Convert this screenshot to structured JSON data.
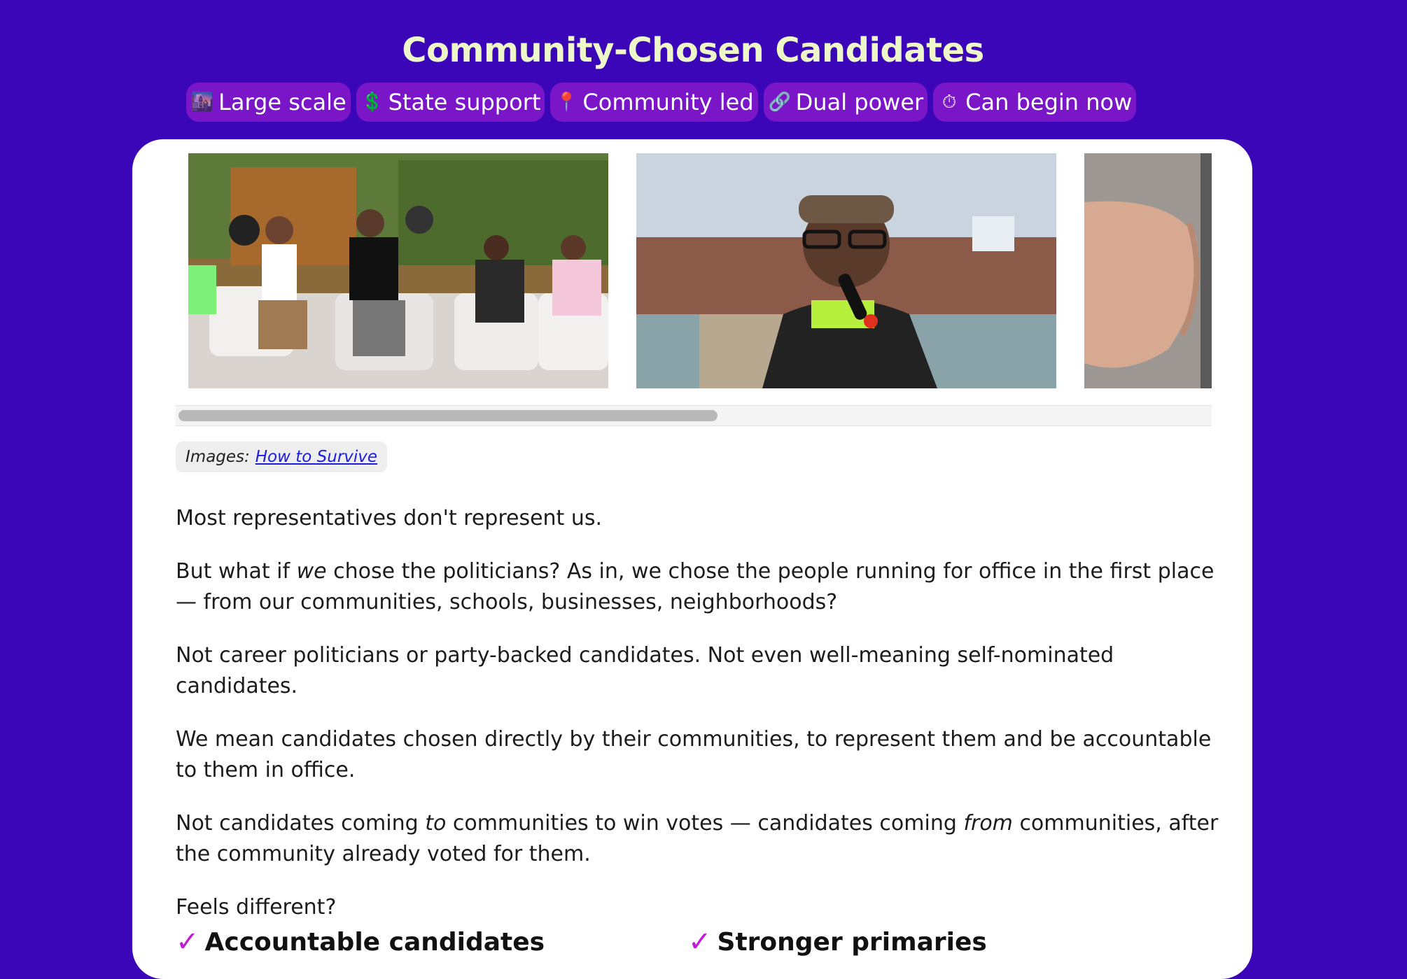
{
  "header": {
    "title": "Community-Chosen Candidates"
  },
  "tags": [
    {
      "icon": "cityscape-icon",
      "glyph": "🌆",
      "label": "Large scale"
    },
    {
      "icon": "dollar-icon",
      "glyph": "💲",
      "label": "State support"
    },
    {
      "icon": "pin-icon",
      "glyph": "📍",
      "label": "Community led"
    },
    {
      "icon": "link-icon",
      "glyph": "🔗",
      "label": "Dual power"
    },
    {
      "icon": "stopwatch-icon",
      "glyph": "⏱",
      "label": "Can begin now"
    }
  ],
  "gallery": {
    "images": [
      {
        "name": "panel-discussion-photo"
      },
      {
        "name": "speaker-with-microphone-photo"
      },
      {
        "name": "finger-closeup-photo"
      }
    ]
  },
  "credit": {
    "prefix": "Images:",
    "link_text": "How to Survive"
  },
  "content": {
    "p1": "Most representatives don't represent us.",
    "p2_before": "But what if ",
    "p2_em": "we",
    "p2_after": " chose the politicians? As in, we chose the people running for office in the first place — from our communities, schools, businesses, neighborhoods?",
    "p3": "Not career politicians or party-backed candidates. Not even well-meaning self-nominated candidates.",
    "p4": "We mean candidates chosen directly by their communities, to represent them and be accountable to them in office.",
    "p5_a": "Not candidates coming ",
    "p5_em1": "to",
    "p5_b": " communities to win votes — candidates coming ",
    "p5_em2": "from",
    "p5_c": " communities, after the community already voted for them.",
    "p6": "Feels different?"
  },
  "benefits": [
    {
      "check": "✓",
      "label": "Accountable candidates"
    },
    {
      "check": "✓",
      "label": "Stronger primaries"
    }
  ],
  "colors": {
    "background": "#3b05b8",
    "title": "#eef7c8",
    "tag": "#7a16c8",
    "check": "#c21bd6",
    "link": "#1d1de0"
  }
}
